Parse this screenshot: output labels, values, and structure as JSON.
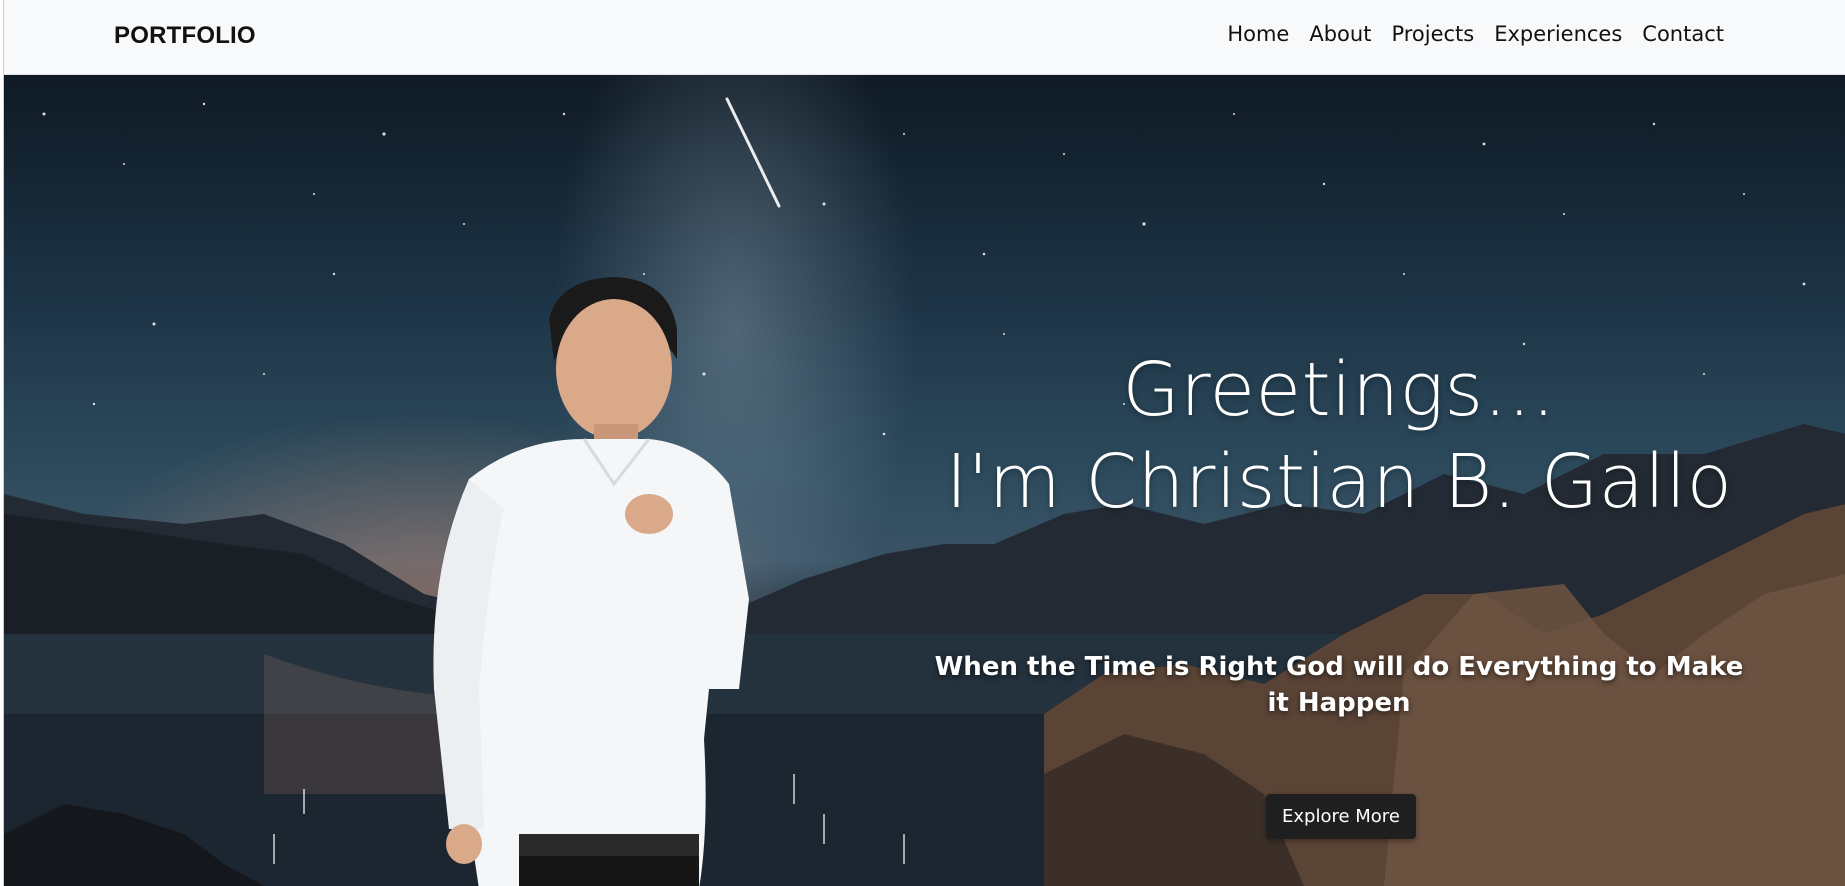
{
  "navbar": {
    "brand": "PORTFOLIO",
    "links": [
      "Home",
      "About",
      "Projects",
      "Experiences",
      "Contact"
    ]
  },
  "hero": {
    "greeting_line1": "Greetings...",
    "greeting_line2": "I'm Christian B. Gallo",
    "quote": "When the Time is Right God will do Everything to Make it Happen",
    "cta_label": "Explore More"
  },
  "colors": {
    "navbar_bg": "#f8f9fa",
    "text_dark": "#111111",
    "button_bg": "#1f1f1f",
    "hero_text": "#ffffff"
  }
}
